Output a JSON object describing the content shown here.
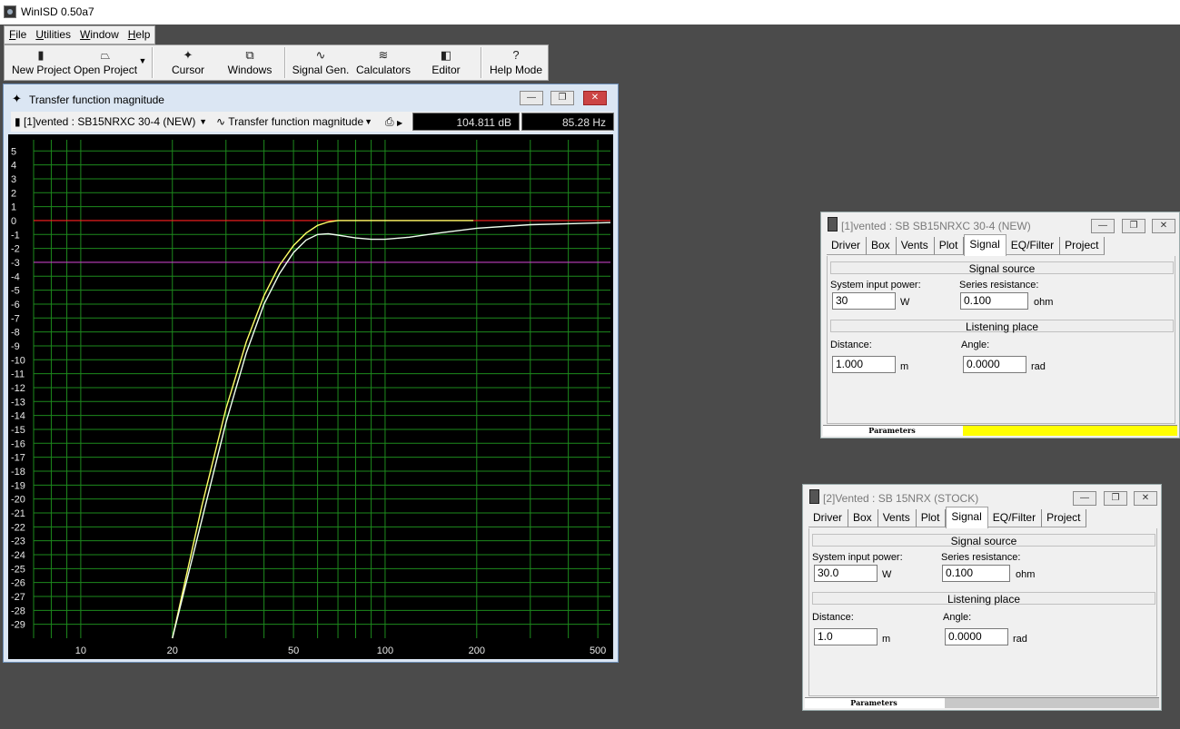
{
  "app": {
    "title": "WinISD 0.50a7"
  },
  "menu": [
    {
      "first": "F",
      "rest": "ile"
    },
    {
      "first": "U",
      "rest": "tilities"
    },
    {
      "first": "W",
      "rest": "indow"
    },
    {
      "first": "H",
      "rest": "elp"
    }
  ],
  "toolbar": {
    "new_project": "New Project",
    "open_project": "Open Project",
    "cursor": "Cursor",
    "windows": "Windows",
    "signal_gen": "Signal Gen.",
    "calculators": "Calculators",
    "editor": "Editor",
    "help_mode": "Help Mode"
  },
  "plot_window": {
    "title": "Transfer function magnitude",
    "project_select": "[1]vented : SB15NRXC 30-4 (NEW)",
    "plot_type_select": "Transfer function magnitude",
    "readout_db": "104.811 dB",
    "readout_hz": "85.28 Hz"
  },
  "chart_data": {
    "type": "line",
    "x_scale": "log",
    "xlim": [
      7,
      550
    ],
    "ylim": [
      -30,
      5.8
    ],
    "x_tick_labels": [
      "10",
      "20",
      "50",
      "100",
      "200",
      "500"
    ],
    "x_ticks": [
      10,
      20,
      50,
      100,
      200,
      500
    ],
    "y_ticks": [
      5,
      4,
      3,
      2,
      1,
      0,
      -1,
      -2,
      -3,
      -4,
      -5,
      -6,
      -7,
      -8,
      -9,
      -10,
      -11,
      -12,
      -13,
      -14,
      -15,
      -16,
      -17,
      -18,
      -19,
      -20,
      -21,
      -22,
      -23,
      -24,
      -25,
      -26,
      -27,
      -28,
      -29
    ],
    "reference_lines": [
      {
        "y": 0,
        "color": "#ff2020"
      },
      {
        "y": -3,
        "color": "#c040c0"
      }
    ],
    "grid": true,
    "series": [
      {
        "color": "#ffff66",
        "x": [
          20,
          25,
          30,
          35,
          40,
          45,
          50,
          55,
          60,
          65,
          70,
          80,
          100,
          150,
          195
        ],
        "y": [
          -30,
          -20.5,
          -13.5,
          -8.7,
          -5.4,
          -3.2,
          -1.8,
          -0.9,
          -0.35,
          -0.1,
          0,
          0,
          0,
          0,
          0
        ]
      },
      {
        "color": "#f0fff0",
        "x": [
          20,
          25,
          30,
          35,
          40,
          45,
          50,
          55,
          60,
          65,
          70,
          80,
          90,
          100,
          120,
          150,
          200,
          300,
          550
        ],
        "y": [
          -30,
          -21.5,
          -14.5,
          -9.5,
          -6.0,
          -3.8,
          -2.3,
          -1.4,
          -1.0,
          -0.95,
          -1.05,
          -1.25,
          -1.35,
          -1.35,
          -1.2,
          -0.9,
          -0.55,
          -0.3,
          -0.15
        ]
      }
    ]
  },
  "param_windows": [
    {
      "title": "[1]vented : SB SB15NRXC 30-4 (NEW)",
      "tabs": [
        "Driver",
        "Box",
        "Vents",
        "Plot",
        "Signal",
        "EQ/Filter",
        "Project"
      ],
      "active_tab": "Signal",
      "signal_source": "Signal source",
      "system_input_power_label": "System input power:",
      "system_input_power": "30",
      "power_unit": "W",
      "series_resistance_label": "Series resistance:",
      "series_resistance": "0.100",
      "resistance_unit": "ohm",
      "listening_place": "Listening place",
      "distance_label": "Distance:",
      "distance": "1.000",
      "distance_unit": "m",
      "angle_label": "Angle:",
      "angle": "0.0000",
      "angle_unit": "rad",
      "status_label": "Parameters",
      "status_color": "#ffff00"
    },
    {
      "title": "[2]Vented : SB 15NRX (STOCK)",
      "tabs": [
        "Driver",
        "Box",
        "Vents",
        "Plot",
        "Signal",
        "EQ/Filter",
        "Project"
      ],
      "active_tab": "Signal",
      "signal_source": "Signal source",
      "system_input_power_label": "System input power:",
      "system_input_power": "30.0",
      "power_unit": "W",
      "series_resistance_label": "Series resistance:",
      "series_resistance": "0.100",
      "resistance_unit": "ohm",
      "listening_place": "Listening place",
      "distance_label": "Distance:",
      "distance": "1.0",
      "distance_unit": "m",
      "angle_label": "Angle:",
      "angle": "0.0000",
      "angle_unit": "rad",
      "status_label": "Parameters",
      "status_color": "#c8c8c8"
    }
  ]
}
